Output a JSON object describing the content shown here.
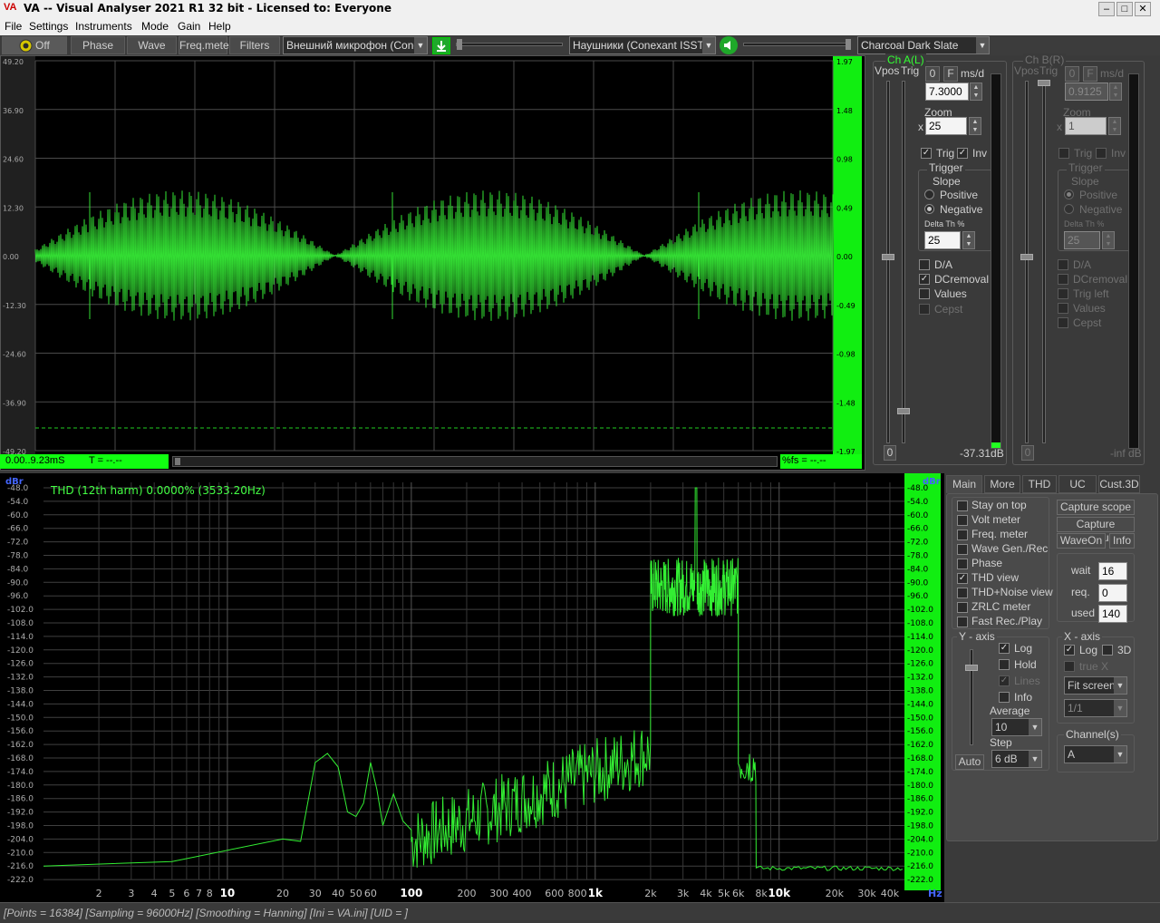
{
  "app": {
    "logo": "VA",
    "title": "VA -- Visual Analyser 2021 R1 32 bit - Licensed to: Everyone"
  },
  "menu": [
    "File",
    "Settings",
    "Instruments",
    "Mode",
    "Gain",
    "Help"
  ],
  "toolbar": {
    "off_label": "Off",
    "phase_label": "Phase",
    "wave_label": "Wave",
    "freq_meter_label": "Freq.meter",
    "filters_label": "Filters",
    "input_device": "Внешний микрофон (Conexa",
    "output_device": "Наушники (Conexant ISST Au",
    "theme": "Charcoal Dark Slate"
  },
  "scope": {
    "left_ticks": [
      "49.20",
      "36.90",
      "24.60",
      "12.30",
      "0.00",
      "-12.30",
      "-24.60",
      "-36.90",
      "-49.20"
    ],
    "right_ticks": [
      "1.97",
      "1.48",
      "0.98",
      "0.49",
      "0.00",
      "-0.49",
      "-0.98",
      "-1.48",
      "-1.97"
    ],
    "time_range": "0.00..9.23mS",
    "t_readout": "T = --.--",
    "fs_readout": "%fs = --.--"
  },
  "chA": {
    "title": "Ch A(L)",
    "vpos": "Vpos",
    "trig": "Trig",
    "btn_0": "0",
    "btn_f": "F",
    "unit": "ms/d",
    "msd_value": "7.3000",
    "zoom_label": "Zoom",
    "zoom_x": "x",
    "zoom_value": "25",
    "trig_cb": "Trig",
    "inv_cb": "Inv",
    "trigger_group": "Trigger",
    "slope_label": "Slope",
    "positive": "Positive",
    "negative": "Negative",
    "delta_th": "Delta Th %",
    "delta_value": "25",
    "da": "D/A",
    "dcremoval": "DCremoval",
    "values": "Values",
    "cepst": "Cepst",
    "vpos_value": "0",
    "level_readout": "-37.31dB"
  },
  "chB": {
    "title": "Ch B(R)",
    "vpos": "Vpos",
    "trig": "Trig",
    "btn_0": "0",
    "btn_f": "F",
    "unit": "ms/d",
    "msd_value": "0.9125",
    "zoom_label": "Zoom",
    "zoom_x": "x",
    "zoom_value": "1",
    "trig_cb": "Trig",
    "inv_cb": "Inv",
    "trigger_group": "Trigger",
    "slope_label": "Slope",
    "positive": "Positive",
    "negative": "Negative",
    "delta_th": "Delta Th %",
    "delta_value": "25",
    "da": "D/A",
    "dcremoval": "DCremoval",
    "trig_left": "Trig left",
    "values": "Values",
    "cepst": "Cepst",
    "vpos_value": "0",
    "level_readout": "-inf dB"
  },
  "spectrum": {
    "unit_left": "dBr",
    "unit_right": "dBr",
    "thd_readout": "THD (12th harm) 0.0000% (3533.20Hz)",
    "hz_label": "Hz",
    "y_ticks": [
      "-48.0",
      "-54.0",
      "-60.0",
      "-66.0",
      "-72.0",
      "-78.0",
      "-84.0",
      "-90.0",
      "-96.0",
      "-102.0",
      "-108.0",
      "-114.0",
      "-120.0",
      "-126.0",
      "-132.0",
      "-138.0",
      "-144.0",
      "-150.0",
      "-156.0",
      "-162.0",
      "-168.0",
      "-174.0",
      "-180.0",
      "-186.0",
      "-192.0",
      "-198.0",
      "-204.0",
      "-210.0",
      "-216.0",
      "-222.0"
    ],
    "x_ticks": [
      "2",
      "3",
      "4",
      "5",
      "6",
      "7",
      "8",
      "10",
      "20",
      "30",
      "40",
      "50",
      "60",
      "100",
      "200",
      "300",
      "400",
      "600",
      "800",
      "1k",
      "2k",
      "3k",
      "4k",
      "5k",
      "6k",
      "8k",
      "10k",
      "20k",
      "30k",
      "40k"
    ]
  },
  "tabs": [
    "Main",
    "More",
    "THD",
    "UC",
    "Cust.3D"
  ],
  "main": {
    "stay_on_top": "Stay on top",
    "volt_meter": "Volt meter",
    "freq_meter": "Freq. meter",
    "wave_gen": "Wave Gen./Rec",
    "phase": "Phase",
    "thd_view": "THD view",
    "thd_noise_view": "THD+Noise view",
    "zrlc_meter": "ZRLC meter",
    "fast_rec": "Fast Rec./Play",
    "capture_scope": "Capture scope",
    "capture_spectrum": "Capture spectrum",
    "waveon": "WaveOn",
    "info": "Info",
    "wait_label": "wait",
    "wait_value": "16",
    "req_label": "req.",
    "req_value": "0",
    "used_label": "used",
    "used_value": "140",
    "y_axis": "Y - axis",
    "log": "Log",
    "hold": "Hold",
    "lines": "Lines",
    "info_cb": "Info",
    "average_label": "Average",
    "average_value": "10",
    "step_label": "Step",
    "step_value": "6 dB",
    "auto": "Auto",
    "x_axis": "X - axis",
    "x_log": "Log",
    "x_3d": "3D",
    "true_x": "true X",
    "fit_screen": "Fit screen",
    "ratio": "1/1",
    "channels": "Channel(s)",
    "channel_value": "A"
  },
  "status": "[Points = 16384]  [Sampling = 96000Hz]  [Smoothing = Hanning]  [Ini = VA.ini]  [UID = ]"
}
